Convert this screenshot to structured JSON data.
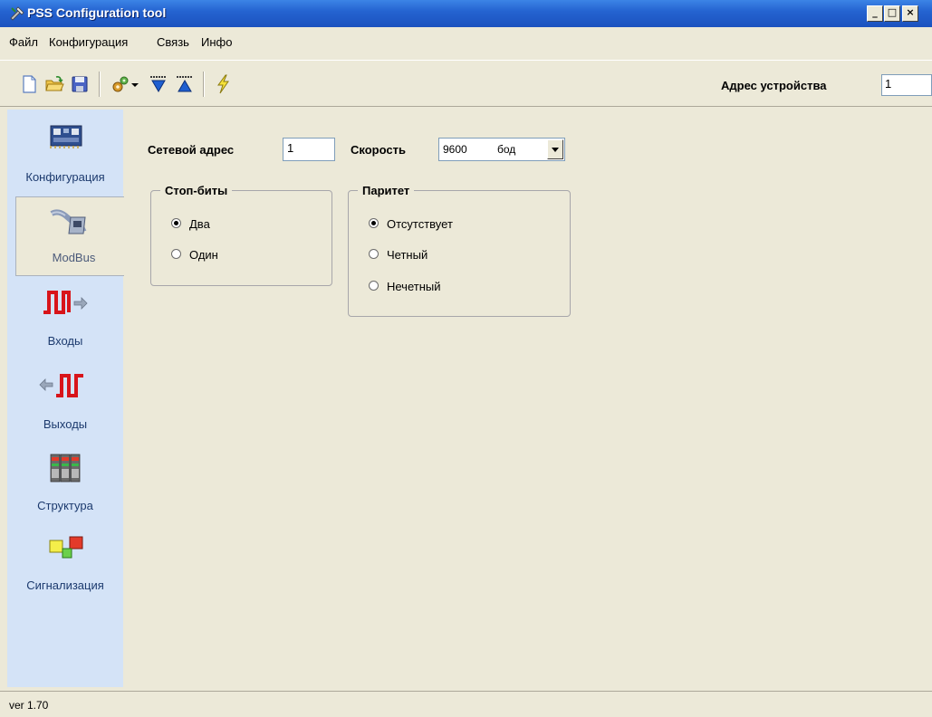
{
  "window": {
    "title": "PSS Configuration tool",
    "controls": {
      "minimize": "_",
      "maximize": "□",
      "close": "×"
    }
  },
  "menu": [
    {
      "label": "Файл"
    },
    {
      "label": "Конфигурация"
    },
    {
      "label": "Связь"
    },
    {
      "label": "Инфо"
    }
  ],
  "toolbar": {
    "icons": [
      "new-file-icon",
      "open-folder-icon",
      "save-icon",
      "gear-dropdown-icon",
      "download-icon",
      "upload-icon",
      "lightning-icon"
    ],
    "device_address_label": "Адрес устройства",
    "device_address_value": "1"
  },
  "sidebar": {
    "items": [
      {
        "label": "Конфигурация",
        "icon": "board-icon"
      },
      {
        "label": "ModBus",
        "icon": "connector-icon",
        "active": true
      },
      {
        "label": "Входы",
        "icon": "input-signal-icon"
      },
      {
        "label": "Выходы",
        "icon": "output-signal-icon"
      },
      {
        "label": "Структура",
        "icon": "structure-icon"
      },
      {
        "label": "Сигнализация",
        "icon": "alarm-icon"
      }
    ]
  },
  "modbus": {
    "network_address_label": "Сетевой адрес",
    "network_address_value": "1",
    "speed_label": "Скорость",
    "speed_value": "9600",
    "speed_unit": "бод",
    "stopbits": {
      "title": "Стоп-биты",
      "options": [
        {
          "label": "Два",
          "selected": true
        },
        {
          "label": "Один",
          "selected": false
        }
      ]
    },
    "parity": {
      "title": "Паритет",
      "options": [
        {
          "label": "Отсутствует",
          "selected": true
        },
        {
          "label": "Четный",
          "selected": false
        },
        {
          "label": "Нечетный",
          "selected": false
        }
      ]
    }
  },
  "status": {
    "version": "ver 1.70"
  },
  "colors": {
    "sidebar_bg": "#d4e3f7",
    "window_bg": "#ece9d8",
    "title_bar": "#2564d1"
  }
}
